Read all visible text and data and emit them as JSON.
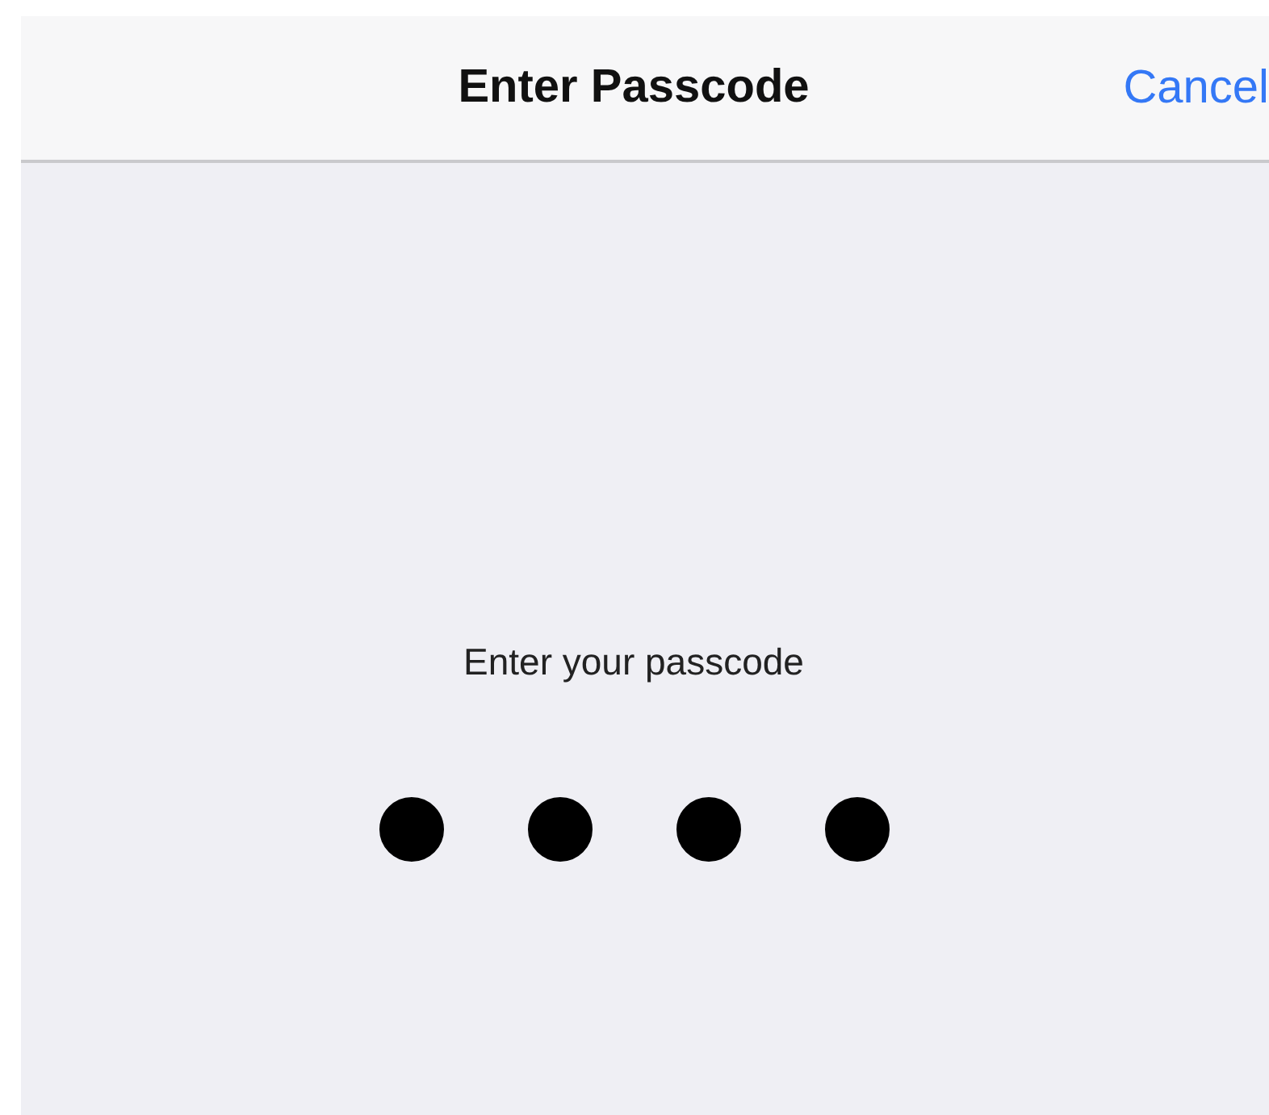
{
  "nav_bar": {
    "title": "Enter Passcode",
    "cancel_button": "Cancel"
  },
  "prompt": "Enter your passcode",
  "passcode_dots": [
    {
      "filled": true
    },
    {
      "filled": true
    },
    {
      "filled": true
    },
    {
      "filled": true
    }
  ]
}
